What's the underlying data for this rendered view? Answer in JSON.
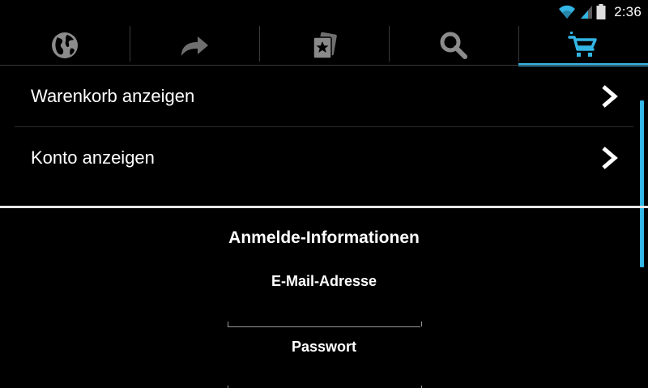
{
  "status_bar": {
    "time": "2:36",
    "icons": [
      "wifi-icon",
      "signal-icon",
      "battery-icon"
    ],
    "accent": "#33b5e5"
  },
  "tabs": [
    {
      "icon": "globe-icon",
      "active": false
    },
    {
      "icon": "share-icon",
      "active": false
    },
    {
      "icon": "favorites-icon",
      "active": false
    },
    {
      "icon": "search-icon",
      "active": false
    },
    {
      "icon": "cart-icon",
      "active": true
    }
  ],
  "menu": {
    "items": [
      {
        "label": "Warenkorb anzeigen",
        "icon": "chevron-right-icon"
      },
      {
        "label": "Konto anzeigen",
        "icon": "chevron-right-icon"
      }
    ]
  },
  "login": {
    "title": "Anmelde-Informationen",
    "email_label": "E-Mail-Adresse",
    "email_value": "",
    "password_label": "Passwort",
    "password_value": ""
  },
  "colors": {
    "background": "#000000",
    "accent": "#33b5e5",
    "text": "#ffffff",
    "icon_gray": "#9a9a9a"
  }
}
